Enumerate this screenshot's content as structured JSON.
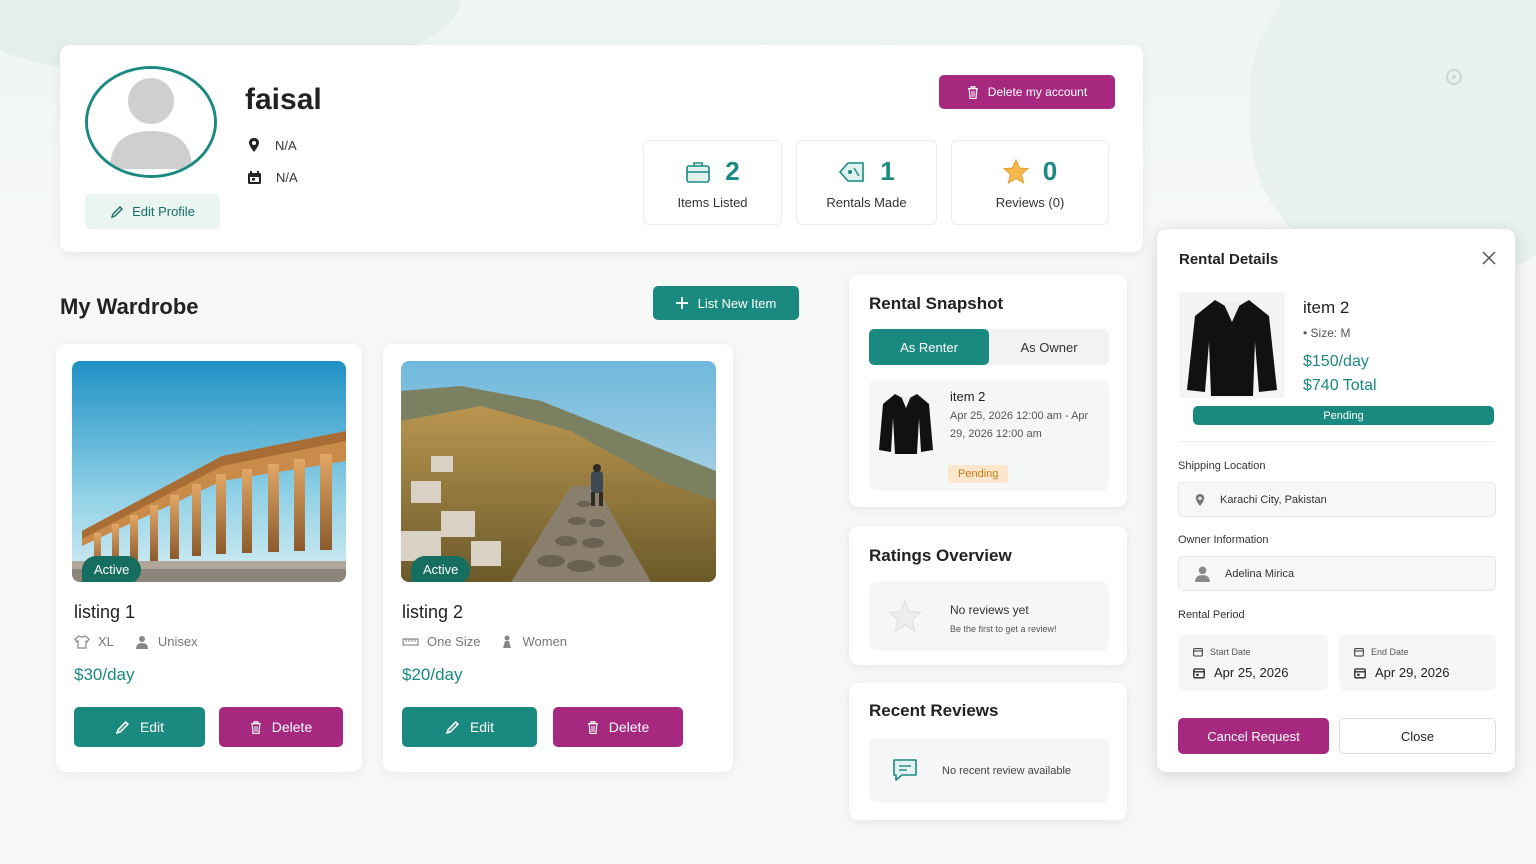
{
  "colors": {
    "teal": "#1a8a80",
    "magenta": "#a7297f",
    "pending_bg": "#fde7cc",
    "pending_text": "#cc7a12"
  },
  "profile": {
    "username": "faisal",
    "location": "N/A",
    "joined": "N/A",
    "edit_label": "Edit Profile",
    "delete_label": "Delete my account",
    "stats": [
      {
        "value": "2",
        "label": "Items Listed",
        "icon": "shopping-bag-icon"
      },
      {
        "value": "1",
        "label": "Rentals Made",
        "icon": "tag-icon"
      },
      {
        "value": "0",
        "label": "Reviews (0)",
        "icon": "star-icon"
      }
    ]
  },
  "wardrobe": {
    "title": "My Wardrobe",
    "list_new_label": "List New Item",
    "items": [
      {
        "name": "listing 1",
        "status": "Active",
        "size": "XL",
        "gender": "Unisex",
        "price": "$30/day",
        "edit": "Edit",
        "delete": "Delete"
      },
      {
        "name": "listing 2",
        "status": "Active",
        "size": "One Size",
        "gender": "Women",
        "price": "$20/day",
        "edit": "Edit",
        "delete": "Delete"
      }
    ]
  },
  "snapshot": {
    "title": "Rental Snapshot",
    "tab_renter": "As Renter",
    "tab_owner": "As Owner",
    "item_name": "item 2",
    "dates": "Apr 25, 2026 12:00 am - Apr 29, 2026 12:00 am",
    "status": "Pending"
  },
  "ratings": {
    "title": "Ratings Overview",
    "empty_title": "No reviews yet",
    "empty_sub": "Be the first to get a review!"
  },
  "recent": {
    "title": "Recent Reviews",
    "empty": "No recent review available"
  },
  "rental_details": {
    "title": "Rental Details",
    "item_name": "item 2",
    "size": "Size: M",
    "per_day": "$150/day",
    "total": "$740 Total",
    "status": "Pending",
    "shipping_label": "Shipping Location",
    "shipping_value": "Karachi City, Pakistan",
    "owner_label": "Owner Information",
    "owner_value": "Adelina Mirica",
    "period_label": "Rental Period",
    "start_label": "Start Date",
    "start_value": "Apr 25, 2026",
    "end_label": "End Date",
    "end_value": "Apr 29, 2026",
    "cancel_label": "Cancel Request",
    "close_label": "Close"
  }
}
